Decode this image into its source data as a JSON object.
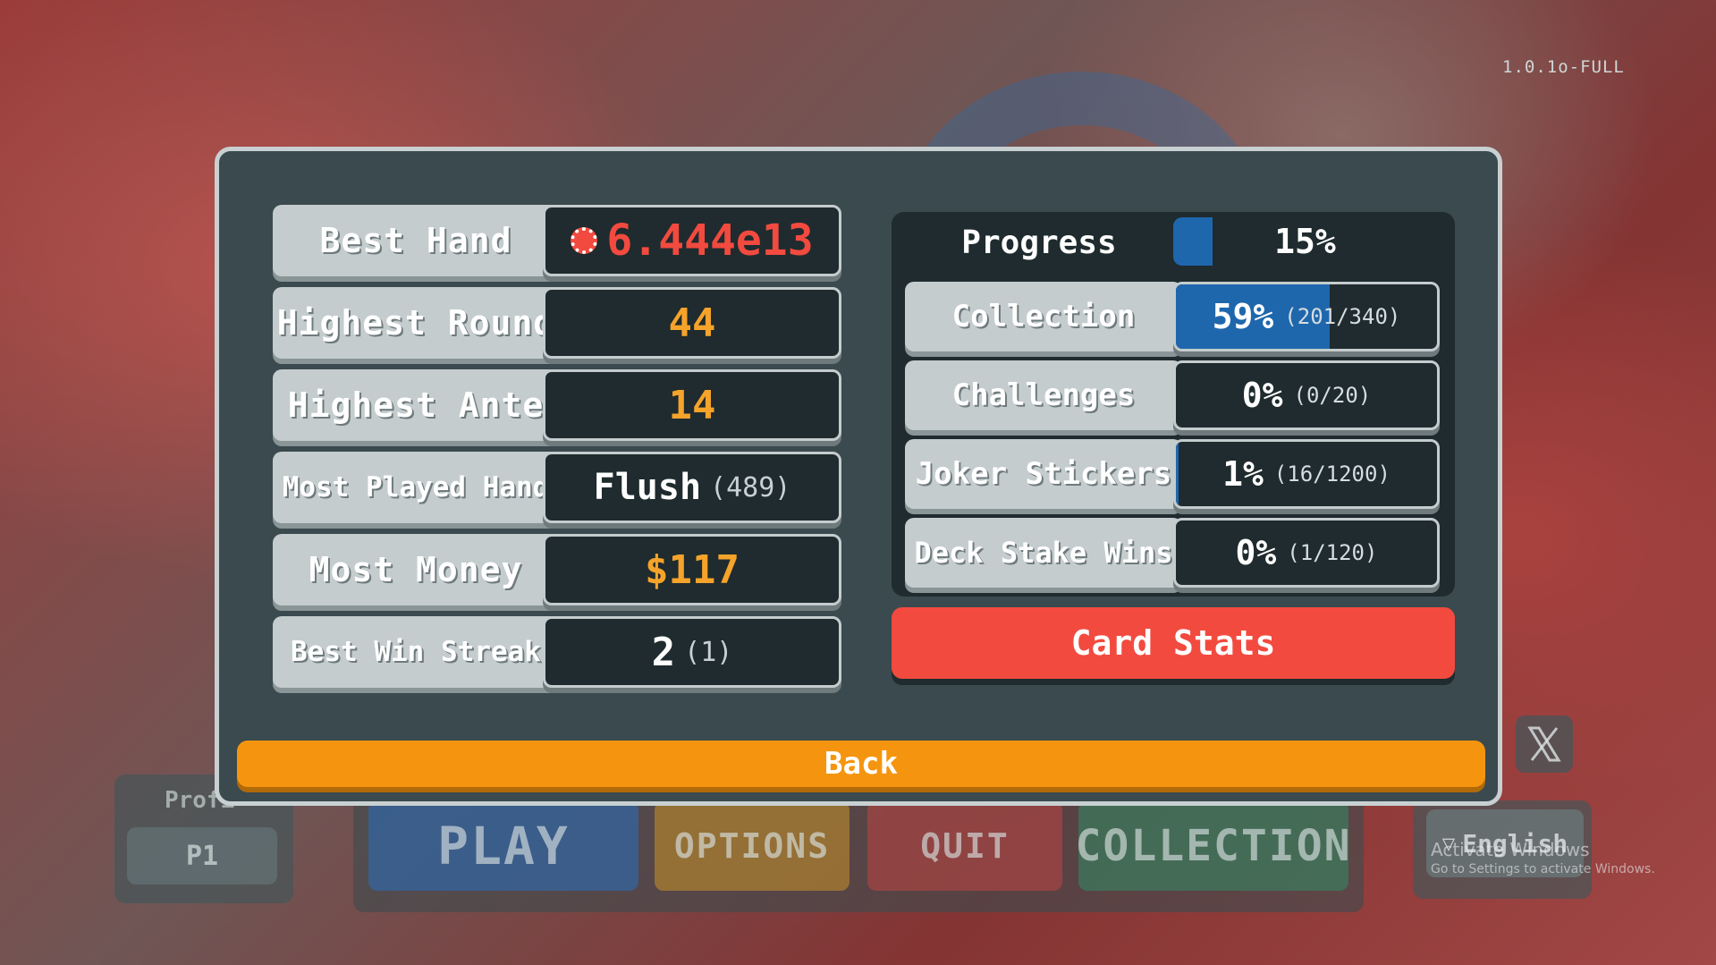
{
  "version": "1.0.1o-FULL",
  "stats": {
    "best_hand": {
      "label": "Best Hand",
      "value": "6.444e13"
    },
    "highest_round": {
      "label": "Highest Round",
      "value": "44"
    },
    "highest_ante": {
      "label": "Highest Ante",
      "value": "14"
    },
    "most_played_hand": {
      "label": "Most Played Hand",
      "value": "Flush",
      "sub": "(489)"
    },
    "most_money": {
      "label": "Most Money",
      "value": "$117"
    },
    "best_win_streak": {
      "label": "Best Win Streak",
      "value": "2",
      "sub": "(1)"
    }
  },
  "progress": {
    "title": "Progress",
    "overall": {
      "value": "15%",
      "fraction": 0.15
    },
    "rows": [
      {
        "label": "Collection",
        "value": "59%",
        "sub": "(201/340)",
        "fraction": 0.59
      },
      {
        "label": "Challenges",
        "value": "0%",
        "sub": "(0/20)",
        "fraction": 0.0
      },
      {
        "label": "Joker Stickers",
        "value": "1%",
        "sub": "(16/1200)",
        "fraction": 0.01
      },
      {
        "label": "Deck Stake Wins",
        "value": "0%",
        "sub": "(1/120)",
        "fraction": 0.0
      }
    ]
  },
  "buttons": {
    "card_stats": "Card Stats",
    "back": "Back"
  },
  "background_menu": {
    "profile_label": "Profi",
    "profile": "P1",
    "play": "PLAY",
    "options": "OPTIONS",
    "quit": "QUIT",
    "collection": "COLLECTION",
    "language": "English"
  },
  "watermark": {
    "line1": "Activate Windows",
    "line2": "Go to Settings to activate Windows."
  },
  "colors": {
    "red": "#f24a3f",
    "orange": "#f5a32a",
    "back": "#f5950f",
    "progress_blue": "#1f67ad",
    "panel": "#3a4a4e"
  }
}
